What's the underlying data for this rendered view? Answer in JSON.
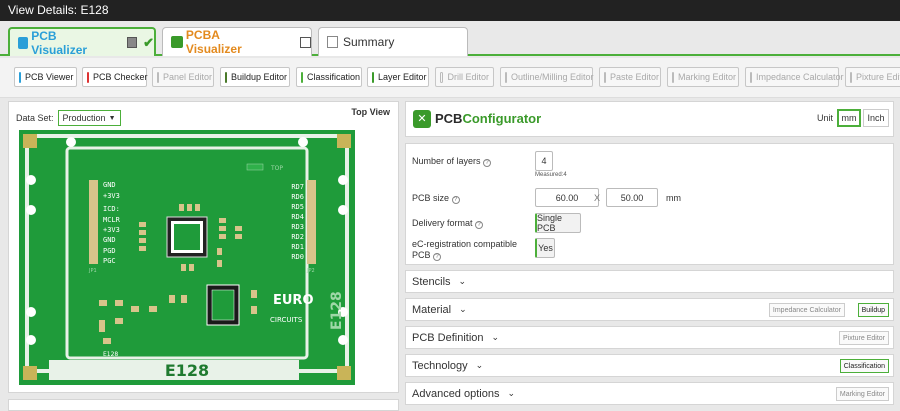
{
  "window": {
    "title": "View Details: E128"
  },
  "tabs": [
    {
      "label": "PCB Visualizer",
      "checked": true
    },
    {
      "label": "PCBA Visualizer",
      "checked": false
    },
    {
      "label": "Summary"
    }
  ],
  "toolbar": {
    "buttons": [
      "PCB Viewer",
      "PCB Checker",
      "Panel Editor",
      "Buildup Editor",
      "Classification",
      "Layer Editor",
      "Drill Editor",
      "Outline/Milling Editor",
      "Paste Editor",
      "Marking Editor",
      "Impedance Calculator",
      "Pixture Editor"
    ]
  },
  "viewer": {
    "dataset_label": "Data Set:",
    "dataset_value": "Production",
    "view_label": "Top View",
    "board": {
      "name": "E128",
      "left_pins": [
        "GND",
        "+3V3",
        "ICD:",
        "MCLR",
        "+3V3",
        "GND",
        "PGD",
        "PGC"
      ],
      "right_pins": [
        "RD7",
        "RD6",
        "RD5",
        "RD4",
        "RD3",
        "RD2",
        "RD1",
        "RD0"
      ],
      "brand_top": "EURO",
      "brand_bottom": "CIRCUITS",
      "vertical_text": "E128",
      "silk_small": "E128",
      "top_tag": "TOP",
      "jp_left": "JP1",
      "jp_right": "JP2"
    }
  },
  "configurator": {
    "brand_a": "PCB",
    "brand_b": "Configurator",
    "unit_label": "Unit",
    "unit_mm": "mm",
    "unit_inch": "Inch",
    "layers_label": "Number of layers",
    "layers_value": "4",
    "layers_measured": "Measured:4",
    "size_label": "PCB size",
    "size_x": "60.00",
    "size_sep": "X",
    "size_y": "50.00",
    "size_unit": "mm",
    "delivery_label": "Delivery format",
    "delivery_value": "Single PCB",
    "ereg_label_1": "eC-registration compatible",
    "ereg_label_2": "PCB",
    "ereg_value": "Yes"
  },
  "sections": [
    {
      "label": "Stencils",
      "buttons": []
    },
    {
      "label": "Material",
      "buttons": [
        "Impedance Calculator",
        "Buildup"
      ]
    },
    {
      "label": "PCB Definition",
      "buttons": [
        "Pixture Editor"
      ]
    },
    {
      "label": "Technology",
      "buttons": [
        "Classification"
      ]
    },
    {
      "label": "Advanced options",
      "buttons": [
        "Marking Editor"
      ]
    }
  ]
}
